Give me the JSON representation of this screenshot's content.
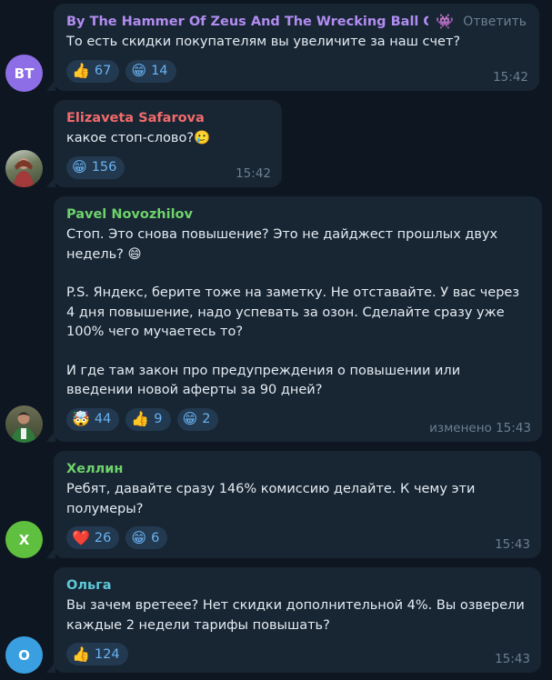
{
  "chat": {
    "reply_label": "Ответить",
    "messages": [
      {
        "author": "By The Hammer Of Zeus And The Wrecking Ball Of ...",
        "author_color": "#b18cf1",
        "avatar_text": "BT",
        "avatar_color": "#8e6ee6",
        "paragraphs": [
          "То есть скидки покупателям вы увеличите за наш счет?"
        ],
        "reactions": [
          {
            "emoji": "👍",
            "count": "67"
          },
          {
            "emoji": "😁",
            "count": "14"
          }
        ],
        "time": "15:42"
      },
      {
        "author": "Elizaveta Safarova",
        "author_color": "#f26b6b",
        "avatar_text": "",
        "avatar_color": "#5a6b4a",
        "paragraphs": [
          "какое стоп-слово?🥲"
        ],
        "reactions": [
          {
            "emoji": "😁",
            "count": "156"
          }
        ],
        "time": "15:42"
      },
      {
        "author": "Pavel Novozhilov",
        "author_color": "#6ed36b",
        "avatar_text": "",
        "avatar_color": "#4f5a3e",
        "paragraphs": [
          "Стоп. Это снова повышение? Это не дайджест прошлых двух недель? 😄",
          "P.S. Яндекс, берите тоже на заметку. Не отставайте. У вас через 4 дня повышение, надо успевать за озон. Сделайте сразу уже 100% чего мучаетесь то?",
          "И где там закон про предупреждения о повышении или введении новой аферты за 90 дней?"
        ],
        "reactions": [
          {
            "emoji": "🤯",
            "count": "44"
          },
          {
            "emoji": "👍",
            "count": "9"
          },
          {
            "emoji": "😁",
            "count": "2"
          }
        ],
        "time": "изменено 15:43"
      },
      {
        "author": "Хеллин",
        "author_color": "#6ed36b",
        "avatar_text": "X",
        "avatar_color": "#5fbf3e",
        "paragraphs": [
          "Ребят, давайте сразу 146% комиссию делайте. К чему эти полумеры?"
        ],
        "reactions": [
          {
            "emoji": "❤️",
            "count": "26"
          },
          {
            "emoji": "😁",
            "count": "6"
          }
        ],
        "time": "15:43"
      },
      {
        "author": "Ольга",
        "author_color": "#5ec8d8",
        "avatar_text": "О",
        "avatar_color": "#3a9fe0",
        "paragraphs": [
          "Вы зачем вретееe? Нет скидки дополнительной 4%. Вы озверели каждые 2 недели тарифы повышать?"
        ],
        "reactions": [
          {
            "emoji": "👍",
            "count": "124"
          }
        ],
        "time": "15:43"
      }
    ]
  }
}
